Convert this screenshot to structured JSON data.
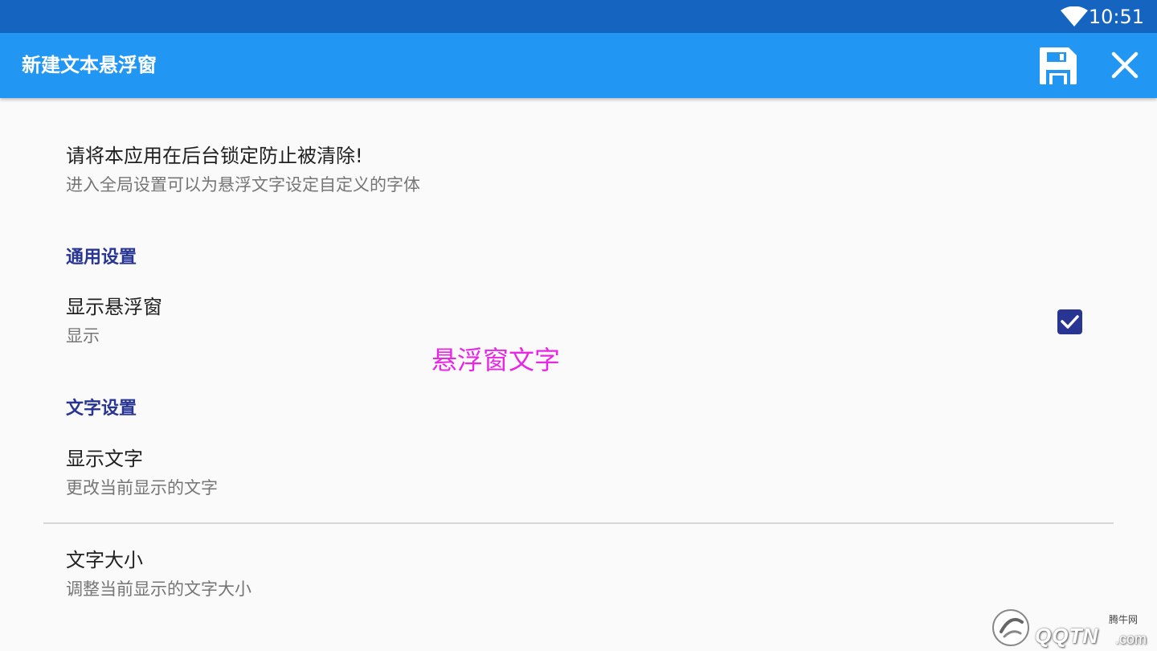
{
  "status_bar": {
    "time": "10:51",
    "wifi_icon": "wifi-icon"
  },
  "app_bar": {
    "title": "新建文本悬浮窗",
    "save_icon": "save-icon",
    "close_icon": "close-icon"
  },
  "notice": {
    "title": "请将本应用在后台锁定防止被清除!",
    "summary": "进入全局设置可以为悬浮文字设定自定义的字体"
  },
  "general_category": {
    "label": "通用设置"
  },
  "show_floating": {
    "title": "显示悬浮窗",
    "summary": "显示",
    "checked": true
  },
  "floating_preview": {
    "text": "悬浮窗文字",
    "color": "#ea26e6"
  },
  "text_category": {
    "label": "文字设置"
  },
  "show_text": {
    "title": "显示文字",
    "summary": "更改当前显示的文字"
  },
  "text_size": {
    "title": "文字大小",
    "summary": "调整当前显示的文字大小"
  },
  "watermark": {
    "small": "腾牛网",
    "big": "QQTN",
    "suffix": ".com"
  },
  "colors": {
    "status_bar": "#1565c0",
    "app_bar": "#2196f3",
    "accent": "#283593",
    "background": "#fafafa"
  }
}
